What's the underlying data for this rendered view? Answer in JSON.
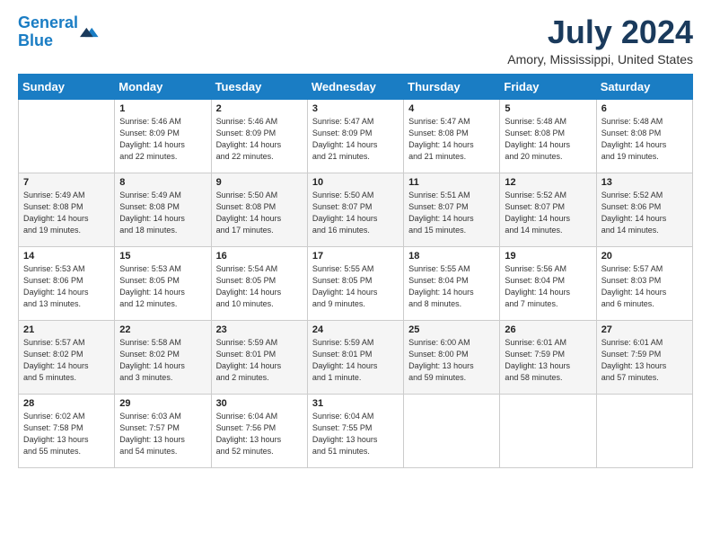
{
  "header": {
    "logo_line1": "General",
    "logo_line2": "Blue",
    "month_title": "July 2024",
    "location": "Amory, Mississippi, United States"
  },
  "weekdays": [
    "Sunday",
    "Monday",
    "Tuesday",
    "Wednesday",
    "Thursday",
    "Friday",
    "Saturday"
  ],
  "weeks": [
    [
      {
        "day": "",
        "info": ""
      },
      {
        "day": "1",
        "info": "Sunrise: 5:46 AM\nSunset: 8:09 PM\nDaylight: 14 hours\nand 22 minutes."
      },
      {
        "day": "2",
        "info": "Sunrise: 5:46 AM\nSunset: 8:09 PM\nDaylight: 14 hours\nand 22 minutes."
      },
      {
        "day": "3",
        "info": "Sunrise: 5:47 AM\nSunset: 8:09 PM\nDaylight: 14 hours\nand 21 minutes."
      },
      {
        "day": "4",
        "info": "Sunrise: 5:47 AM\nSunset: 8:08 PM\nDaylight: 14 hours\nand 21 minutes."
      },
      {
        "day": "5",
        "info": "Sunrise: 5:48 AM\nSunset: 8:08 PM\nDaylight: 14 hours\nand 20 minutes."
      },
      {
        "day": "6",
        "info": "Sunrise: 5:48 AM\nSunset: 8:08 PM\nDaylight: 14 hours\nand 19 minutes."
      }
    ],
    [
      {
        "day": "7",
        "info": "Sunrise: 5:49 AM\nSunset: 8:08 PM\nDaylight: 14 hours\nand 19 minutes."
      },
      {
        "day": "8",
        "info": "Sunrise: 5:49 AM\nSunset: 8:08 PM\nDaylight: 14 hours\nand 18 minutes."
      },
      {
        "day": "9",
        "info": "Sunrise: 5:50 AM\nSunset: 8:08 PM\nDaylight: 14 hours\nand 17 minutes."
      },
      {
        "day": "10",
        "info": "Sunrise: 5:50 AM\nSunset: 8:07 PM\nDaylight: 14 hours\nand 16 minutes."
      },
      {
        "day": "11",
        "info": "Sunrise: 5:51 AM\nSunset: 8:07 PM\nDaylight: 14 hours\nand 15 minutes."
      },
      {
        "day": "12",
        "info": "Sunrise: 5:52 AM\nSunset: 8:07 PM\nDaylight: 14 hours\nand 14 minutes."
      },
      {
        "day": "13",
        "info": "Sunrise: 5:52 AM\nSunset: 8:06 PM\nDaylight: 14 hours\nand 14 minutes."
      }
    ],
    [
      {
        "day": "14",
        "info": "Sunrise: 5:53 AM\nSunset: 8:06 PM\nDaylight: 14 hours\nand 13 minutes."
      },
      {
        "day": "15",
        "info": "Sunrise: 5:53 AM\nSunset: 8:05 PM\nDaylight: 14 hours\nand 12 minutes."
      },
      {
        "day": "16",
        "info": "Sunrise: 5:54 AM\nSunset: 8:05 PM\nDaylight: 14 hours\nand 10 minutes."
      },
      {
        "day": "17",
        "info": "Sunrise: 5:55 AM\nSunset: 8:05 PM\nDaylight: 14 hours\nand 9 minutes."
      },
      {
        "day": "18",
        "info": "Sunrise: 5:55 AM\nSunset: 8:04 PM\nDaylight: 14 hours\nand 8 minutes."
      },
      {
        "day": "19",
        "info": "Sunrise: 5:56 AM\nSunset: 8:04 PM\nDaylight: 14 hours\nand 7 minutes."
      },
      {
        "day": "20",
        "info": "Sunrise: 5:57 AM\nSunset: 8:03 PM\nDaylight: 14 hours\nand 6 minutes."
      }
    ],
    [
      {
        "day": "21",
        "info": "Sunrise: 5:57 AM\nSunset: 8:02 PM\nDaylight: 14 hours\nand 5 minutes."
      },
      {
        "day": "22",
        "info": "Sunrise: 5:58 AM\nSunset: 8:02 PM\nDaylight: 14 hours\nand 3 minutes."
      },
      {
        "day": "23",
        "info": "Sunrise: 5:59 AM\nSunset: 8:01 PM\nDaylight: 14 hours\nand 2 minutes."
      },
      {
        "day": "24",
        "info": "Sunrise: 5:59 AM\nSunset: 8:01 PM\nDaylight: 14 hours\nand 1 minute."
      },
      {
        "day": "25",
        "info": "Sunrise: 6:00 AM\nSunset: 8:00 PM\nDaylight: 13 hours\nand 59 minutes."
      },
      {
        "day": "26",
        "info": "Sunrise: 6:01 AM\nSunset: 7:59 PM\nDaylight: 13 hours\nand 58 minutes."
      },
      {
        "day": "27",
        "info": "Sunrise: 6:01 AM\nSunset: 7:59 PM\nDaylight: 13 hours\nand 57 minutes."
      }
    ],
    [
      {
        "day": "28",
        "info": "Sunrise: 6:02 AM\nSunset: 7:58 PM\nDaylight: 13 hours\nand 55 minutes."
      },
      {
        "day": "29",
        "info": "Sunrise: 6:03 AM\nSunset: 7:57 PM\nDaylight: 13 hours\nand 54 minutes."
      },
      {
        "day": "30",
        "info": "Sunrise: 6:04 AM\nSunset: 7:56 PM\nDaylight: 13 hours\nand 52 minutes."
      },
      {
        "day": "31",
        "info": "Sunrise: 6:04 AM\nSunset: 7:55 PM\nDaylight: 13 hours\nand 51 minutes."
      },
      {
        "day": "",
        "info": ""
      },
      {
        "day": "",
        "info": ""
      },
      {
        "day": "",
        "info": ""
      }
    ]
  ]
}
